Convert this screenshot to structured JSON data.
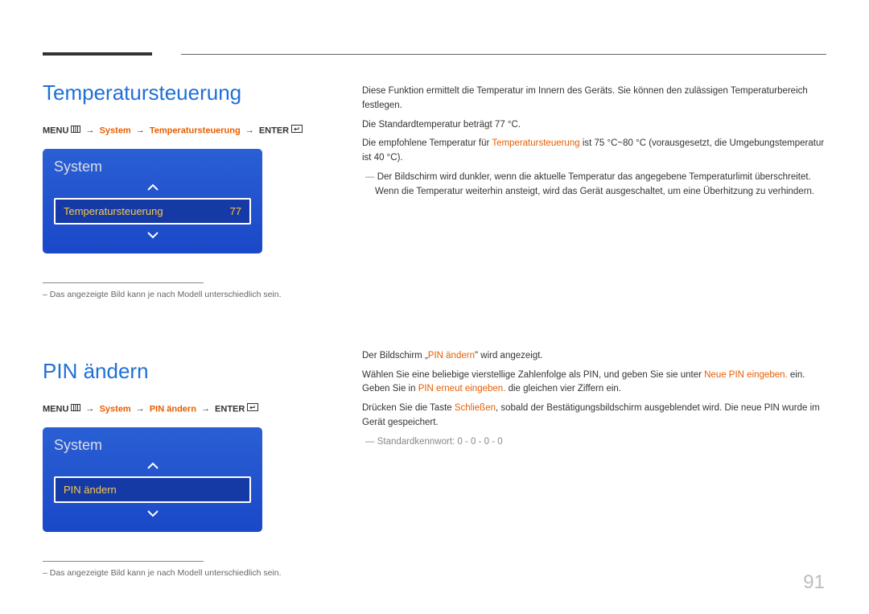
{
  "pageNumber": "91",
  "sections": [
    {
      "title": "Temperatursteuerung",
      "breadcrumb": {
        "menu": "MENU",
        "p1": "System",
        "p2": "Temperatursteuerung",
        "enter": "ENTER"
      },
      "menuBox": {
        "title": "System",
        "item": {
          "label": "Temperatursteuerung",
          "value": "77"
        }
      },
      "note": "Das angezeigte Bild kann je nach Modell unterschiedlich sein.",
      "body": {
        "p1": "Diese Funktion ermittelt die Temperatur im Innern des Geräts. Sie können den zulässigen Temperaturbereich festlegen.",
        "p2": "Die Standardtemperatur beträgt 77 °C.",
        "p3_a": "Die empfohlene Temperatur für ",
        "p3_k": "Temperatursteuerung",
        "p3_b": " ist 75 °C~80 °C (vorausgesetzt, die Umgebungstemperatur ist 40 °C).",
        "dash1": "Der Bildschirm wird dunkler, wenn die aktuelle Temperatur das angegebene Temperaturlimit überschreitet. Wenn die Temperatur weiterhin ansteigt, wird das Gerät ausgeschaltet, um eine Überhitzung zu verhindern."
      }
    },
    {
      "title": "PIN ändern",
      "breadcrumb": {
        "menu": "MENU",
        "p1": "System",
        "p2": "PIN ändern",
        "enter": "ENTER"
      },
      "menuBox": {
        "title": "System",
        "item": {
          "label": "PIN ändern",
          "value": ""
        }
      },
      "note": "Das angezeigte Bild kann je nach Modell unterschiedlich sein.",
      "body": {
        "p1_a": "Der Bildschirm „",
        "p1_k": "PIN ändern",
        "p1_b": "\" wird angezeigt.",
        "p2_a": "Wählen Sie eine beliebige vierstellige Zahlenfolge als PIN, und geben Sie sie unter ",
        "p2_k1": "Neue PIN eingeben.",
        "p2_b": " ein. Geben Sie in ",
        "p2_k2": "PIN erneut eingeben.",
        "p2_c": " die gleichen vier Ziffern ein.",
        "p3_a": "Drücken Sie die Taste ",
        "p3_k": "Schließen",
        "p3_b": ", sobald der Bestätigungsbildschirm ausgeblendet wird. Die neue PIN wurde im Gerät gespeichert.",
        "dash1": "Standardkennwort: 0 - 0 - 0 - 0"
      }
    }
  ]
}
